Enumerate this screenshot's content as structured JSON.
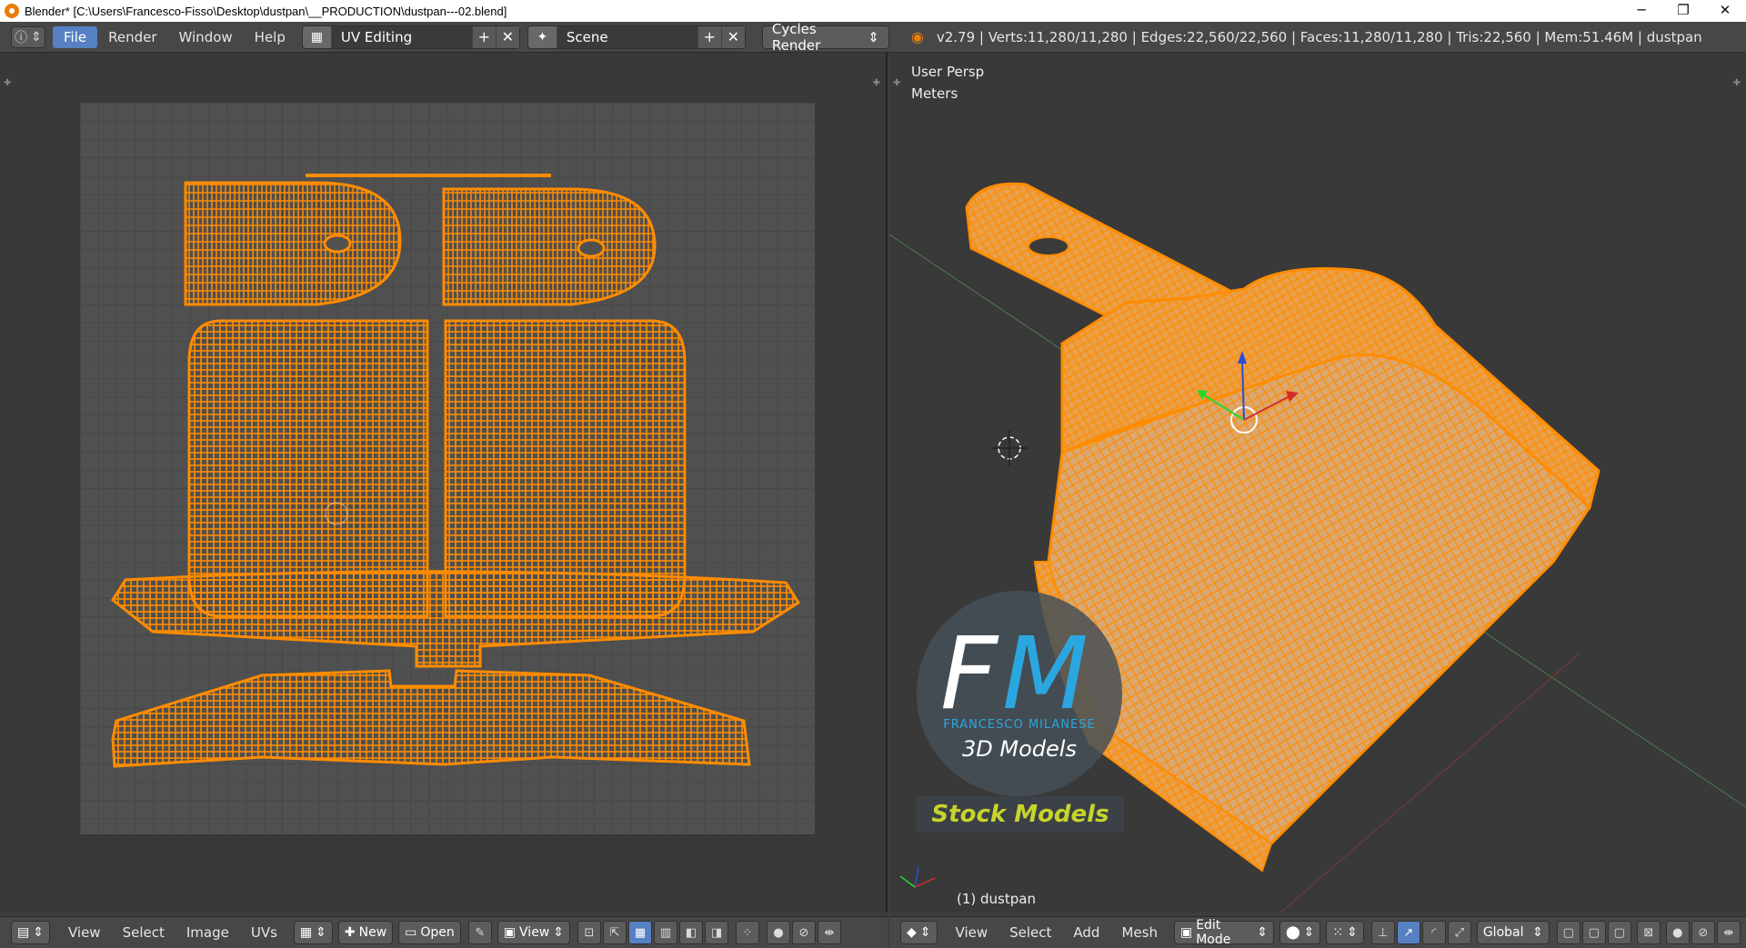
{
  "window": {
    "title": "Blender* [C:\\Users\\Francesco-Fisso\\Desktop\\dustpan\\__PRODUCTION\\dustpan---02.blend]",
    "minimize": "─",
    "maximize": "❐",
    "close": "✕"
  },
  "topbar": {
    "info_icon": "info-icon",
    "menus": [
      "File",
      "Render",
      "Window",
      "Help"
    ],
    "screen_layout": "UV Editing",
    "scene": "Scene",
    "render_engine": "Cycles Render",
    "stats": "v2.79 | Verts:11,280/11,280 | Edges:22,560/22,560 | Faces:11,280/11,280 | Tris:22,560 | Mem:51.46M | dustpan"
  },
  "uv_editor": {
    "menus": [
      "View",
      "Select",
      "Image",
      "UVs"
    ],
    "new_label": "New",
    "open_label": "Open",
    "view_label": "View"
  },
  "viewport": {
    "view_name": "User Persp",
    "units": "Meters",
    "object_label": "(1) dustpan",
    "menus": [
      "View",
      "Select",
      "Add",
      "Mesh"
    ],
    "mode": "Edit Mode",
    "orientation": "Global"
  },
  "watermark": {
    "f": "F",
    "m": "M",
    "name": "FRANCESCO MILANESE",
    "subtitle": "3D Models",
    "stock": "Stock Models"
  },
  "colors": {
    "wire": "#ff8c00",
    "mesh_face": "#d9a873",
    "selected_menu": "#5680c2"
  }
}
